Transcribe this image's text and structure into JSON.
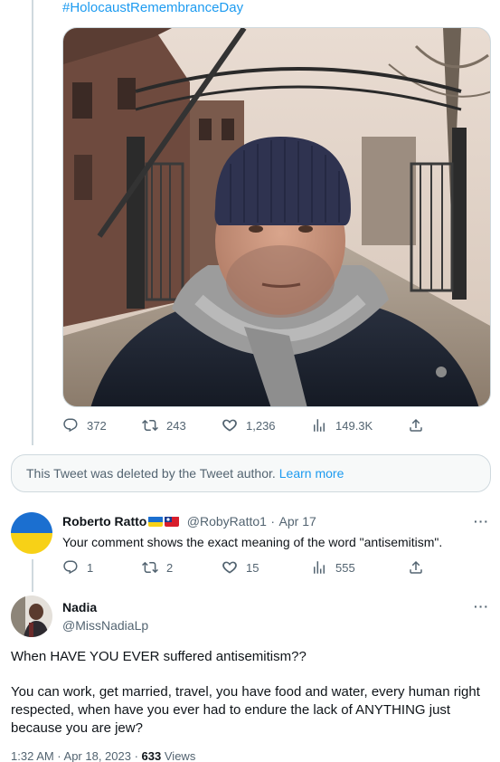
{
  "tweet1": {
    "hashtag": "#HolocaustRemembranceDay",
    "stats": {
      "replies": "372",
      "retweets": "243",
      "likes": "1,236",
      "views": "149.3K"
    }
  },
  "deleted_notice": {
    "text": "This Tweet was deleted by the Tweet author.",
    "link": "Learn more"
  },
  "reply1": {
    "name": "Roberto Ratto",
    "handle": "@RobyRatto1",
    "separator": "·",
    "date": "Apr 17",
    "text": "Your comment shows the exact meaning of the word \"antisemitism\".",
    "stats": {
      "replies": "1",
      "retweets": "2",
      "likes": "15",
      "views": "555"
    },
    "more": "···"
  },
  "reply2": {
    "name": "Nadia",
    "handle": "@MissNadiaLp",
    "more": "···",
    "para1": "When HAVE YOU EVER suffered antisemitism??",
    "para2": "You can work, get married, travel, you have food and water, every human right respected, when have you ever had to endure the lack of ANYTHING just because you are jew?",
    "time": "1:32 AM · Apr 18, 2023 ·",
    "views_count": "633",
    "views_label": "Views"
  },
  "colors": {
    "accent": "#1d9bf0",
    "muted": "#536471",
    "text": "#0f1419",
    "border": "#cfd9de"
  },
  "icons": [
    "reply-icon",
    "retweet-icon",
    "like-icon",
    "views-icon",
    "share-icon",
    "more-icon"
  ]
}
